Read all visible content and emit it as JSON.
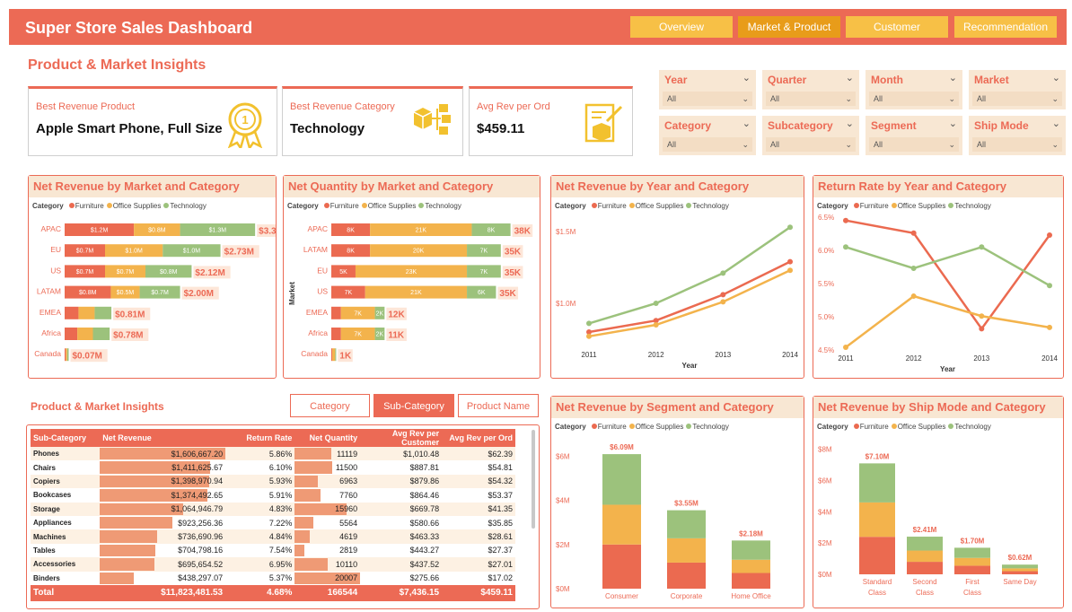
{
  "app": {
    "title": "Super Store Sales Dashboard",
    "nav": [
      "Overview",
      "Market & Product",
      "Customer",
      "Recommendation"
    ],
    "active_nav": "Market & Product"
  },
  "section_title": "Product & Market Insights",
  "kpis": [
    {
      "label": "Best Revenue Product",
      "value": "Apple Smart Phone, Full Size",
      "icon": "award-ribbon-icon"
    },
    {
      "label": "Best Revenue Category",
      "value": "Technology",
      "icon": "category-network-icon"
    },
    {
      "label": "Avg Rev per Ord",
      "value": "$459.11",
      "icon": "order-box-icon"
    }
  ],
  "filters": [
    {
      "label": "Year",
      "value": "All"
    },
    {
      "label": "Quarter",
      "value": "All"
    },
    {
      "label": "Month",
      "value": "All"
    },
    {
      "label": "Market",
      "value": "All"
    },
    {
      "label": "Category",
      "value": "All"
    },
    {
      "label": "Subcategory",
      "value": "All"
    },
    {
      "label": "Segment",
      "value": "All"
    },
    {
      "label": "Ship Mode",
      "value": "All"
    }
  ],
  "legend": {
    "title": "Category",
    "items": [
      "Furniture",
      "Office Supplies",
      "Technology"
    ]
  },
  "colors": {
    "accent": "#ec6a55",
    "furniture": "#eb6a50",
    "office": "#f3b34c",
    "technology": "#9cc27c",
    "header_bg": "#f8e7d3",
    "nav": "#f7c046"
  },
  "chart_data": [
    {
      "id": "rev_market",
      "title": "Net Revenue by Market and Category",
      "type": "bar",
      "orientation": "horizontal",
      "stacked": true,
      "categories": [
        "APAC",
        "EU",
        "US",
        "LATAM",
        "EMEA",
        "Africa",
        "Canada"
      ],
      "series": [
        {
          "name": "Furniture",
          "values": [
            1.2,
            0.7,
            0.7,
            0.8,
            0.24,
            0.22,
            0.02
          ],
          "labels": [
            "$1.2M",
            "$0.7M",
            "$0.7M",
            "$0.8M",
            "",
            "",
            ""
          ]
        },
        {
          "name": "Office Supplies",
          "values": [
            0.8,
            1.0,
            0.7,
            0.5,
            0.28,
            0.27,
            0.025
          ],
          "labels": [
            "$0.8M",
            "$1.0M",
            "$0.7M",
            "$0.5M",
            "",
            "",
            ""
          ]
        },
        {
          "name": "Technology",
          "values": [
            1.3,
            1.0,
            0.8,
            0.7,
            0.29,
            0.29,
            0.025
          ],
          "labels": [
            "$1.3M",
            "$1.0M",
            "$0.8M",
            "$0.7M",
            "",
            "",
            ""
          ]
        }
      ],
      "totals": [
        "$3.32M",
        "$2.73M",
        "$2.12M",
        "$2.00M",
        "$0.81M",
        "$0.78M",
        "$0.07M"
      ]
    },
    {
      "id": "qty_market",
      "title": "Net Quantity by Market and Category",
      "type": "bar",
      "orientation": "horizontal",
      "stacked": true,
      "ylabel": "Market",
      "categories": [
        "APAC",
        "LATAM",
        "EU",
        "US",
        "EMEA",
        "Africa",
        "Canada"
      ],
      "series": [
        {
          "name": "Furniture",
          "values": [
            8,
            8,
            5,
            7,
            2,
            2,
            0.2
          ],
          "labels": [
            "8K",
            "8K",
            "5K",
            "7K",
            "",
            "",
            ""
          ]
        },
        {
          "name": "Office Supplies",
          "values": [
            21,
            20,
            23,
            21,
            7,
            7,
            0.6
          ],
          "labels": [
            "21K",
            "20K",
            "23K",
            "21K",
            "7K",
            "7K",
            ""
          ]
        },
        {
          "name": "Technology",
          "values": [
            8,
            7,
            7,
            6,
            2,
            2,
            0.2
          ],
          "labels": [
            "8K",
            "7K",
            "7K",
            "6K",
            "2K",
            "2K",
            ""
          ]
        }
      ],
      "totals": [
        "38K",
        "35K",
        "35K",
        "35K",
        "12K",
        "11K",
        "1K"
      ]
    },
    {
      "id": "rev_year",
      "title": "Net Revenue by Year and Category",
      "type": "line",
      "x": [
        "2011",
        "2012",
        "2013",
        "2014"
      ],
      "xlabel": "Year",
      "yticks": [
        "$1.0M",
        "$1.5M"
      ],
      "ylim": [
        0.7,
        1.6
      ],
      "series": [
        {
          "name": "Furniture",
          "values": [
            0.8,
            0.88,
            1.06,
            1.29
          ]
        },
        {
          "name": "Office Supplies",
          "values": [
            0.77,
            0.85,
            1.01,
            1.23
          ]
        },
        {
          "name": "Technology",
          "values": [
            0.86,
            1.0,
            1.21,
            1.53
          ]
        }
      ]
    },
    {
      "id": "return_year",
      "title": "Return Rate by Year and Category",
      "type": "line",
      "x": [
        "2011",
        "2012",
        "2013",
        "2014"
      ],
      "xlabel": "Year",
      "yticks": [
        "4.5%",
        "5.0%",
        "5.5%",
        "6.0%",
        "6.5%"
      ],
      "ylim": [
        4.5,
        6.5
      ],
      "series": [
        {
          "name": "Furniture",
          "values": [
            6.45,
            6.26,
            4.82,
            6.23
          ]
        },
        {
          "name": "Office Supplies",
          "values": [
            4.54,
            5.31,
            5.01,
            4.84
          ]
        },
        {
          "name": "Technology",
          "values": [
            6.05,
            5.73,
            6.05,
            5.47
          ]
        }
      ]
    },
    {
      "id": "rev_segment",
      "title": "Net Revenue by Segment and Category",
      "type": "bar",
      "stacked": true,
      "categories": [
        "Consumer",
        "Corporate",
        "Home Office"
      ],
      "yticks": [
        "$0M",
        "$2M",
        "$4M",
        "$6M"
      ],
      "ylim": [
        0,
        6.5
      ],
      "series": [
        {
          "name": "Furniture",
          "values": [
            2.0,
            1.18,
            0.71
          ]
        },
        {
          "name": "Office Supplies",
          "values": [
            1.8,
            1.1,
            0.6
          ]
        },
        {
          "name": "Technology",
          "values": [
            2.29,
            1.27,
            0.87
          ]
        }
      ],
      "totals": [
        "$6.09M",
        "$3.55M",
        "$2.18M"
      ]
    },
    {
      "id": "rev_shipmode",
      "title": "Net Revenue by Ship Mode and Category",
      "type": "bar",
      "stacked": true,
      "categories": [
        "Standard Class",
        "Second Class",
        "First Class",
        "Same Day"
      ],
      "yticks": [
        "$0M",
        "$2M",
        "$4M",
        "$6M",
        "$8M"
      ],
      "ylim": [
        0,
        8.5
      ],
      "series": [
        {
          "name": "Furniture",
          "values": [
            2.4,
            0.8,
            0.55,
            0.2
          ]
        },
        {
          "name": "Office Supplies",
          "values": [
            2.2,
            0.72,
            0.5,
            0.18
          ]
        },
        {
          "name": "Technology",
          "values": [
            2.5,
            0.89,
            0.65,
            0.24
          ]
        }
      ],
      "totals": [
        "$7.10M",
        "$2.41M",
        "$1.70M",
        "$0.62M"
      ]
    },
    {
      "id": "subcategory_table",
      "type": "table",
      "columns": [
        "Sub-Category",
        "Net Revenue",
        "Return Rate",
        "Net Quantity",
        "Avg Rev per Customer",
        "Avg Rev per Ord"
      ],
      "rows": [
        [
          "Phones",
          "$1,606,667.20",
          "5.86%",
          "11119",
          "$1,010.48",
          "$62.39"
        ],
        [
          "Chairs",
          "$1,411,625.67",
          "6.10%",
          "11500",
          "$887.81",
          "$54.81"
        ],
        [
          "Copiers",
          "$1,398,970.94",
          "5.93%",
          "6963",
          "$879.86",
          "$54.32"
        ],
        [
          "Bookcases",
          "$1,374,492.65",
          "5.91%",
          "7760",
          "$864.46",
          "$53.37"
        ],
        [
          "Storage",
          "$1,064,946.79",
          "4.83%",
          "15960",
          "$669.78",
          "$41.35"
        ],
        [
          "Appliances",
          "$923,256.36",
          "7.22%",
          "5564",
          "$580.66",
          "$35.85"
        ],
        [
          "Machines",
          "$736,690.96",
          "4.84%",
          "4619",
          "$463.33",
          "$28.61"
        ],
        [
          "Tables",
          "$704,798.16",
          "7.54%",
          "2819",
          "$443.27",
          "$27.37"
        ],
        [
          "Accessories",
          "$695,654.52",
          "6.95%",
          "10110",
          "$437.52",
          "$27.01"
        ],
        [
          "Binders",
          "$438,297.07",
          "5.37%",
          "20007",
          "$275.66",
          "$17.02"
        ]
      ],
      "total": [
        "Total",
        "$11,823,481.53",
        "4.68%",
        "166544",
        "$7,436.15",
        "$459.11"
      ]
    }
  ],
  "table_section": {
    "title": "Product & Market Insights",
    "tabs": [
      "Category",
      "Sub-Category",
      "Product Name"
    ],
    "active_tab": "Sub-Category"
  }
}
